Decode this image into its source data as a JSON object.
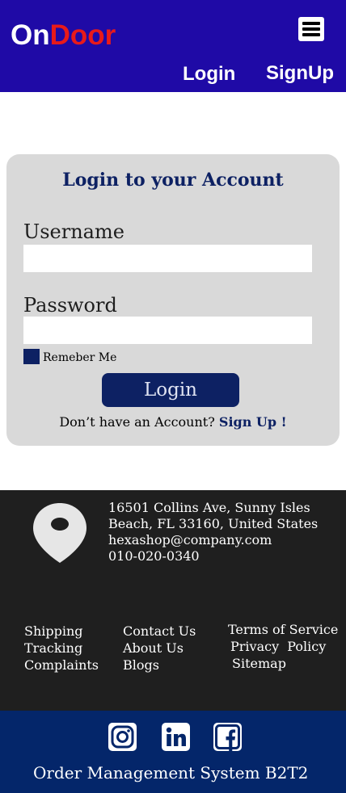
{
  "header": {
    "logo_part1": "On",
    "logo_part2": "Door",
    "nav_login": "Login",
    "nav_signup": "SignUp",
    "menu_icon": "hamburger-menu-icon"
  },
  "login_card": {
    "title": "Login to your Account",
    "username_label": "Username",
    "username_value": "",
    "password_label": "Password",
    "password_value": "",
    "remember_label": "Remeber Me",
    "login_button": "Login",
    "no_account_text": "Don’t have an Account?",
    "signup_link": "Sign Up !"
  },
  "footer": {
    "location_icon": "location-pin-icon",
    "address_line1": "16501 Collins Ave, Sunny Isles",
    "address_line2": "Beach, FL 33160, United States",
    "email": "hexashop@company.com",
    "phone": "010-020-0340",
    "links_col1": [
      "Shipping",
      "Tracking",
      "Complaints"
    ],
    "links_col2": [
      "Contact Us",
      "About Us",
      "Blogs"
    ],
    "links_col3": [
      "Terms of Service",
      "Privacy  Policy",
      "Sitemap"
    ]
  },
  "bottom_bar": {
    "social_icons": [
      "instagram-icon",
      "linkedin-icon",
      "facebook-icon"
    ],
    "text": "Order Management System B2T2"
  },
  "colors": {
    "header_bg": "#1f0aa6",
    "logo_accent": "#e81a1a",
    "card_bg": "#d9d9d9",
    "navy": "#0d2163",
    "footer_bg": "#1f1f1f",
    "bottom_bg": "#04266a"
  }
}
